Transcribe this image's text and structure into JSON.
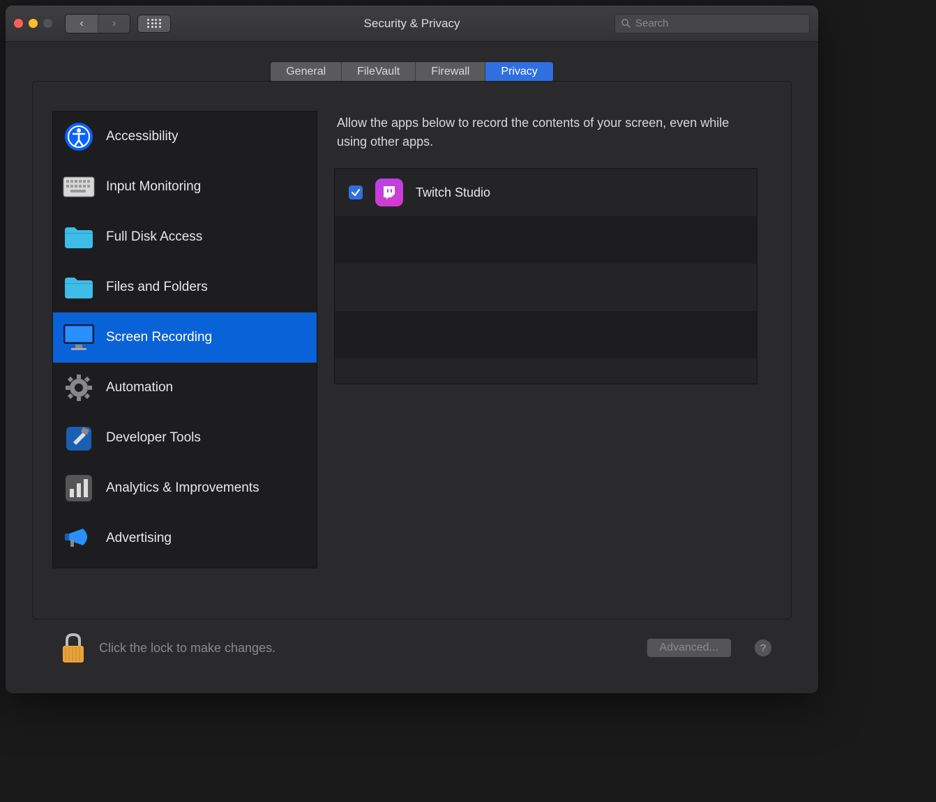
{
  "window": {
    "title": "Security & Privacy"
  },
  "search": {
    "placeholder": "Search"
  },
  "tabs": [
    {
      "label": "General"
    },
    {
      "label": "FileVault"
    },
    {
      "label": "Firewall"
    },
    {
      "label": "Privacy",
      "active": true
    }
  ],
  "sidebar": {
    "items": [
      {
        "label": "Accessibility",
        "icon": "accessibility"
      },
      {
        "label": "Input Monitoring",
        "icon": "keyboard"
      },
      {
        "label": "Full Disk Access",
        "icon": "folder"
      },
      {
        "label": "Files and Folders",
        "icon": "folder"
      },
      {
        "label": "Screen Recording",
        "icon": "display",
        "selected": true
      },
      {
        "label": "Automation",
        "icon": "gear"
      },
      {
        "label": "Developer Tools",
        "icon": "hammer"
      },
      {
        "label": "Analytics & Improvements",
        "icon": "chart"
      },
      {
        "label": "Advertising",
        "icon": "megaphone"
      }
    ]
  },
  "detail": {
    "description": "Allow the apps below to record the contents of your screen, even while using other apps.",
    "apps": [
      {
        "name": "Twitch Studio",
        "checked": true
      }
    ]
  },
  "footer": {
    "lock_text": "Click the lock to make changes.",
    "advanced_label": "Advanced...",
    "help_label": "?"
  }
}
